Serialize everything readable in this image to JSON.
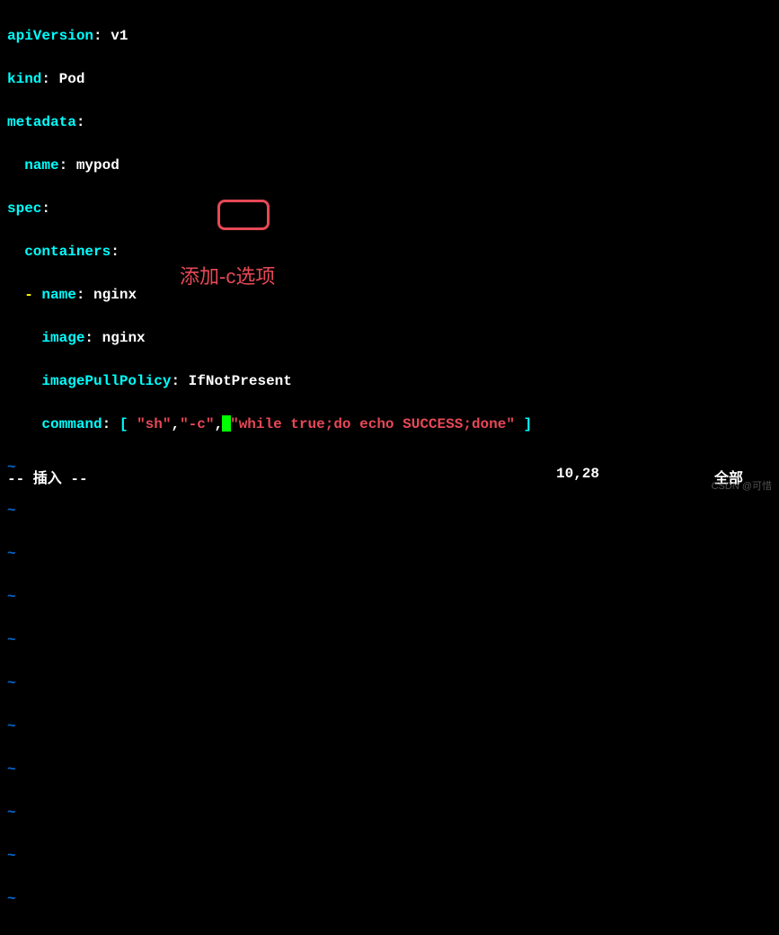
{
  "yaml": {
    "l1_key": "apiVersion",
    "l1_val": "v1",
    "l2_key": "kind",
    "l2_val": "Pod",
    "l3_key": "metadata",
    "l4_key": "name",
    "l4_val": "mypod",
    "l5_key": "spec",
    "l6_key": "containers",
    "l7_key": "name",
    "l7_val": "nginx",
    "l8_key": "image",
    "l8_val": "nginx",
    "l9_key": "imagePullPolicy",
    "l9_val": "IfNotPresent",
    "l10_key": "command",
    "l10_arr0": "\"sh\"",
    "l10_arr1": "\"-c\"",
    "l10_arr2": "\"while true;do echo SUCCESS;done\"",
    "comma": ",",
    "dash": "-",
    "colon": ":",
    "lbracket": "[",
    "rbracket": "]",
    "tilde": "~"
  },
  "annotation": "添加-c选项",
  "status": {
    "mode": "-- 插入 --",
    "position": "10,28",
    "scroll": "全部"
  },
  "watermark": "CSDN @可惜"
}
